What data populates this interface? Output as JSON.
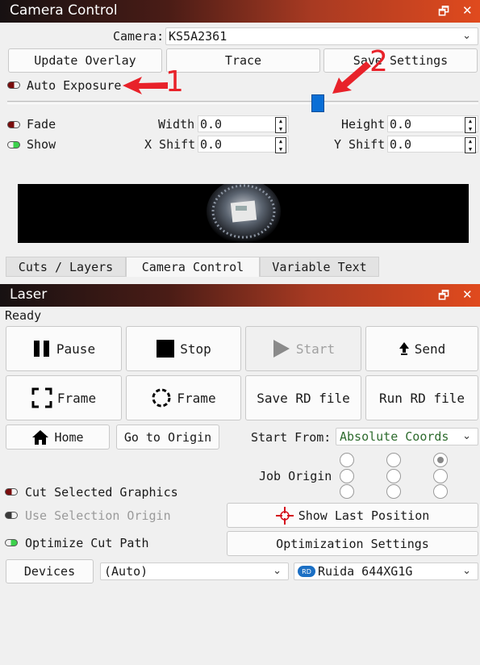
{
  "camera_panel": {
    "title": "Camera Control",
    "camera_label": "Camera:",
    "camera_value": "KS5A2361",
    "buttons": {
      "update_overlay": "Update Overlay",
      "trace": "Trace",
      "save_settings": "Save Settings"
    },
    "auto_exposure": "Auto Exposure",
    "fade": "Fade",
    "show": "Show",
    "width_label": "Width",
    "width_value": "0.0",
    "height_label": "Height",
    "height_value": "0.0",
    "xshift_label": "X Shift",
    "xshift_value": "0.0",
    "yshift_label": "Y Shift",
    "yshift_value": "0.0",
    "slider_value": 0.66,
    "annotations": {
      "one": "1",
      "two": "2"
    }
  },
  "tabs": [
    "Cuts / Layers",
    "Camera Control",
    "Variable Text"
  ],
  "laser_panel": {
    "title": "Laser",
    "status": "Ready",
    "buttons": {
      "pause": "Pause",
      "stop": "Stop",
      "start": "Start",
      "send": "Send",
      "frame1": "Frame",
      "frame2": "Frame",
      "save_rd": "Save RD file",
      "run_rd": "Run RD file",
      "home": "Home",
      "go_origin": "Go to Origin",
      "show_last": "Show Last Position",
      "opt_settings": "Optimization Settings",
      "devices": "Devices"
    },
    "start_from_label": "Start From:",
    "start_from_value": "Absolute Coords",
    "job_origin_label": "Job Origin",
    "cut_selected": "Cut Selected Graphics",
    "use_selection_origin": "Use Selection Origin",
    "optimize_cut_path": "Optimize Cut Path",
    "devices_combo": "(Auto)",
    "device_name": "Ruida 644XG1G",
    "device_icon_text": "RD"
  },
  "colors": {
    "annotation": "#e8222a",
    "slider_handle": "#0a6fd6",
    "title_gradient_end": "#e04a1e"
  }
}
